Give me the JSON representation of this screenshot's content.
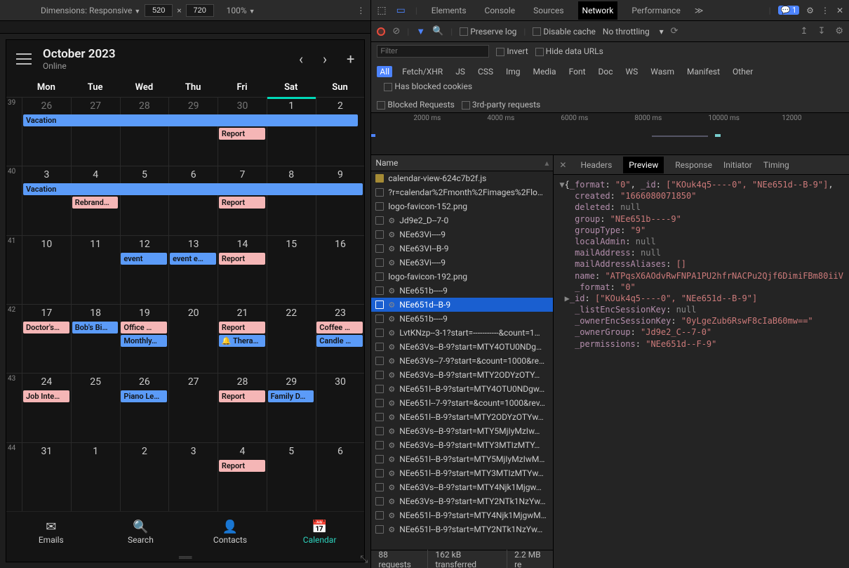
{
  "device_toolbar": {
    "dimensions_label": "Dimensions: Responsive",
    "w": "520",
    "h": "720",
    "zoom": "100%"
  },
  "calendar": {
    "title": "October 2023",
    "status": "Online",
    "days": [
      "Mon",
      "Tue",
      "Wed",
      "Thu",
      "Fri",
      "Sat",
      "Sun"
    ],
    "weeks": [
      {
        "num": "39",
        "days": [
          "26",
          "27",
          "28",
          "29",
          "30",
          "1",
          "2"
        ],
        "todayCol": 5,
        "chips": [
          {
            "text": "Vacation",
            "color": "blue",
            "row": 1,
            "col1": 0,
            "col2": 7,
            "arrow": true
          },
          {
            "text": "Report",
            "color": "pink",
            "row": 2,
            "col1": 4,
            "col2": 5
          }
        ],
        "past": [
          0,
          1,
          2,
          3,
          4
        ]
      },
      {
        "num": "40",
        "days": [
          "3",
          "4",
          "5",
          "6",
          "7",
          "8",
          "9"
        ],
        "chips": [
          {
            "text": "Vacation",
            "color": "blue",
            "row": 1,
            "col1": 0,
            "col2": 7,
            "arrowLeft": true
          },
          {
            "text": "Rebrand…",
            "color": "pink",
            "row": 2,
            "col1": 1,
            "col2": 2
          },
          {
            "text": "Report",
            "color": "pink",
            "row": 2,
            "col1": 4,
            "col2": 5
          }
        ]
      },
      {
        "num": "41",
        "days": [
          "10",
          "11",
          "12",
          "13",
          "14",
          "15",
          "16"
        ],
        "chips": [
          {
            "text": "event",
            "color": "blue",
            "row": 1,
            "col1": 2,
            "col2": 3
          },
          {
            "text": "event e…",
            "color": "blue",
            "row": 1,
            "col1": 3,
            "col2": 4
          },
          {
            "text": "Report",
            "color": "pink",
            "row": 1,
            "col1": 4,
            "col2": 5
          }
        ]
      },
      {
        "num": "42",
        "days": [
          "17",
          "18",
          "19",
          "20",
          "21",
          "22",
          "23"
        ],
        "chips": [
          {
            "text": "Doctor's…",
            "color": "pink",
            "row": 1,
            "col1": 0,
            "col2": 1
          },
          {
            "text": "Bob's Bi…",
            "color": "blue",
            "row": 1,
            "col1": 1,
            "col2": 2
          },
          {
            "text": "Office …",
            "color": "pink",
            "row": 1,
            "col1": 2,
            "col2": 3
          },
          {
            "text": "Monthly…",
            "color": "blue",
            "row": 2,
            "col1": 2,
            "col2": 3
          },
          {
            "text": "Report",
            "color": "pink",
            "row": 1,
            "col1": 4,
            "col2": 5
          },
          {
            "text": "🔔 Therapy…",
            "color": "blue",
            "row": 2,
            "col1": 4,
            "col2": 5
          },
          {
            "text": "Coffee …",
            "color": "pink",
            "row": 1,
            "col1": 6,
            "col2": 7
          },
          {
            "text": "Candle …",
            "color": "blue",
            "row": 2,
            "col1": 6,
            "col2": 7
          }
        ]
      },
      {
        "num": "43",
        "days": [
          "24",
          "25",
          "26",
          "27",
          "28",
          "29",
          "30"
        ],
        "chips": [
          {
            "text": "Job Inte…",
            "color": "pink",
            "row": 1,
            "col1": 0,
            "col2": 1
          },
          {
            "text": "Piano Le…",
            "color": "blue",
            "row": 1,
            "col1": 2,
            "col2": 3
          },
          {
            "text": "Report",
            "color": "pink",
            "row": 1,
            "col1": 4,
            "col2": 5
          },
          {
            "text": "Family D…",
            "color": "blue",
            "row": 1,
            "col1": 5,
            "col2": 6
          }
        ]
      },
      {
        "num": "44",
        "days": [
          "31",
          "1",
          "2",
          "3",
          "4",
          "5",
          "6"
        ],
        "chips": [
          {
            "text": "Report",
            "color": "pink",
            "row": 1,
            "col1": 4,
            "col2": 5
          }
        ]
      }
    ],
    "nav": [
      {
        "icon": "✉",
        "label": "Emails"
      },
      {
        "icon": "🔍",
        "label": "Search"
      },
      {
        "icon": "👤",
        "label": "Contacts"
      },
      {
        "icon": "📅",
        "label": "Calendar",
        "active": true
      }
    ]
  },
  "devtools": {
    "tabs": [
      "Elements",
      "Console",
      "Sources",
      "Network",
      "Performance"
    ],
    "tabs_active": "Network",
    "more": "≫",
    "issue_count": "1",
    "net_toolbar": {
      "preserve": "Preserve log",
      "disable_cache": "Disable cache",
      "throttling": "No throttling"
    },
    "filters": {
      "placeholder": "Filter",
      "invert": "Invert",
      "hide": "Hide data URLs",
      "types": [
        "All",
        "Fetch/XHR",
        "JS",
        "CSS",
        "Img",
        "Media",
        "Font",
        "Doc",
        "WS",
        "Wasm",
        "Manifest",
        "Other"
      ],
      "blocked_cookies": "Has blocked cookies",
      "blocked_req": "Blocked Requests",
      "third_party": "3rd-party requests"
    },
    "timeline_ticks": [
      "2000 ms",
      "4000 ms",
      "6000 ms",
      "8000 ms",
      "10000 ms",
      "12000"
    ],
    "name_header": "Name",
    "requests": [
      {
        "n": "calendar-view-624c7b2f.js",
        "kind": "js"
      },
      {
        "n": "?r=calendar%2Fmonth%2Fimages%2Flo…",
        "kind": "doc"
      },
      {
        "n": "logo-favicon-152.png",
        "kind": "doc"
      },
      {
        "n": "Jd9e2_D--7-0",
        "kind": "xhr"
      },
      {
        "n": "NEe63Vi----9",
        "kind": "xhr"
      },
      {
        "n": "NEe63VI--B-9",
        "kind": "xhr"
      },
      {
        "n": "NEe63Vi----9",
        "kind": "xhr"
      },
      {
        "n": "logo-favicon-192.png",
        "kind": "doc"
      },
      {
        "n": "NEe651b----9",
        "kind": "xhr"
      },
      {
        "n": "NEe651d--B-9",
        "kind": "xhr",
        "sel": true
      },
      {
        "n": "NEe651b----9",
        "kind": "xhr"
      },
      {
        "n": "LvtKNzp--3-1?start=-----------&count=1…",
        "kind": "xhr"
      },
      {
        "n": "NEe63Vs--B-9?start=MTY4OTU0NDg…",
        "kind": "xhr"
      },
      {
        "n": "NEe63Vs--7-9?start=&count=1000&re…",
        "kind": "xhr"
      },
      {
        "n": "NEe63Vs--B-9?start=MTY2ODYzOTY…",
        "kind": "xhr"
      },
      {
        "n": "NEe651l--B-9?start=MTY4OTU0NDgw…",
        "kind": "xhr"
      },
      {
        "n": "NEe651l--7-9?start=&count=1000&rev…",
        "kind": "xhr"
      },
      {
        "n": "NEe651l--B-9?start=MTY2ODYzOTYw…",
        "kind": "xhr"
      },
      {
        "n": "NEe63Vs--B-9?start=MTY5MjIyMzIw…",
        "kind": "xhr"
      },
      {
        "n": "NEe63Vs--B-9?start=MTY3MTIzMTY…",
        "kind": "xhr"
      },
      {
        "n": "NEe651l--B-9?start=MTY5MjIyMzIwM…",
        "kind": "xhr"
      },
      {
        "n": "NEe651l--B-9?start=MTY3MTIzMTYw…",
        "kind": "xhr"
      },
      {
        "n": "NEe63Vs--B-9?start=MTY4Njk1Mjgw…",
        "kind": "xhr"
      },
      {
        "n": "NEe63Vs--B-9?start=MTY2NTk1NzYw…",
        "kind": "xhr"
      },
      {
        "n": "NEe651l--B-9?start=MTY4Njk1MjgwM…",
        "kind": "xhr"
      },
      {
        "n": "NEe651l--B-9?start=MTY2NTk1NzYw…",
        "kind": "xhr"
      }
    ],
    "detail_tabs": [
      "Headers",
      "Preview",
      "Response",
      "Initiator",
      "Timing"
    ],
    "detail_active": "Preview",
    "json": {
      "_format": "\"0\"",
      "_id_hdr": "[\"KOuk4q5----0\", \"NEe651d--B-9\"]",
      "created": "\"1666080071850\"",
      "deleted": "null",
      "group": "\"NEe651b----9\"",
      "groupType": "\"9\"",
      "localAdmin": "null",
      "mailAddress": "null",
      "mailAddressAliases": "[]",
      "name": "\"ATPqsX6AOdvRwFNPA1PU2hfrNACPu2Qjf6DimiFBm80iiV",
      "_format2": "\"0\"",
      "_id": "[\"KOuk4q5----0\", \"NEe651d--B-9\"]",
      "_listEncSessionKey": "null",
      "_ownerEncSessionKey": "\"0yLgeZub6RswF8cIaB60mw==\"",
      "_ownerGroup": "\"Jd9e2_C--7-0\"",
      "_permissions": "\"NEe651d--F-9\""
    },
    "status": {
      "requests": "88 requests",
      "transferred": "162 kB transferred",
      "resources": "2.2 MB re"
    }
  }
}
